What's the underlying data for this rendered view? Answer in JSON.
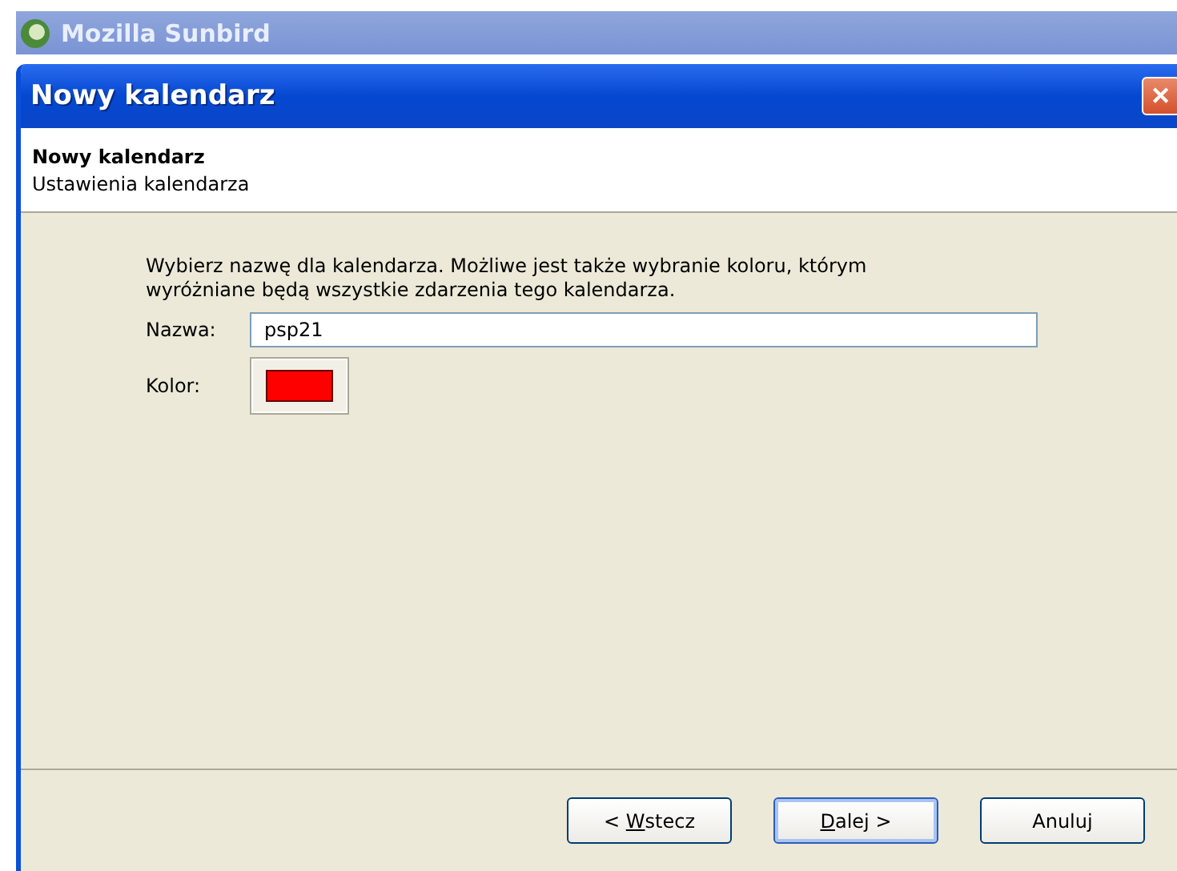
{
  "app_window": {
    "title": "Mozilla Sunbird"
  },
  "dialog": {
    "title": "Nowy kalendarz",
    "close": "✕",
    "header": {
      "title": "Nowy kalendarz",
      "subtitle": "Ustawienia kalendarza"
    },
    "instructions": "Wybierz nazwę dla kalendarza. Możliwe jest także wybranie koloru, którym wyróżniane będą wszystkie zdarzenia tego kalendarza.",
    "name_field": {
      "label": "Nazwa:",
      "value": "psp21"
    },
    "color_field": {
      "label": "Kolor:",
      "color": "#ff0000"
    },
    "buttons": [
      {
        "before": "< ",
        "accesskey": "W",
        "after": "stecz",
        "default": false
      },
      {
        "accesskey": "D",
        "after": "alej >",
        "default": true
      },
      {
        "after": "Anuluj",
        "default": false
      }
    ]
  }
}
